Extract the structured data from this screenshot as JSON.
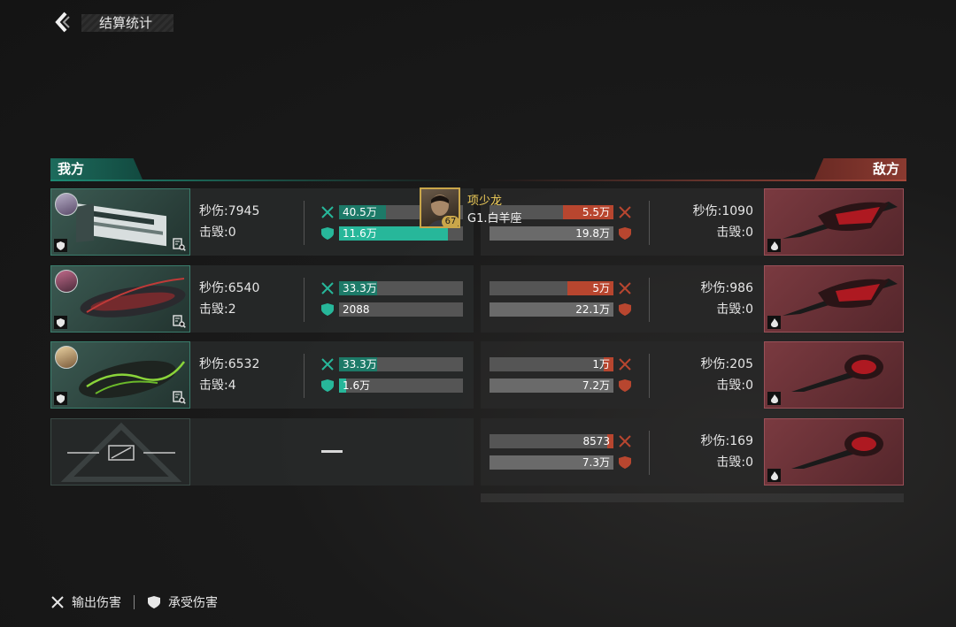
{
  "header": {
    "title": "结算统计"
  },
  "sides": {
    "ours": "我方",
    "enemy": "敌方"
  },
  "mvp": {
    "name": "项少龙",
    "rank": "G1.白羊座",
    "level": "67"
  },
  "ours": [
    {
      "dps": "秒伤:7945",
      "kills": "击毁:0",
      "dealt": "40.5万",
      "dealt_pct": 0.38,
      "taken": "11.6万",
      "taken_pct": 0.88
    },
    {
      "dps": "秒伤:6540",
      "kills": "击毁:2",
      "dealt": "33.3万",
      "dealt_pct": 0.31,
      "taken": "2088",
      "taken_pct": 0.0
    },
    {
      "dps": "秒伤:6532",
      "kills": "击毁:4",
      "dealt": "33.3万",
      "dealt_pct": 0.31,
      "taken": "1.6万",
      "taken_pct": 0.06
    }
  ],
  "enemy": [
    {
      "dps": "秒伤:1090",
      "kills": "击毁:0",
      "dealt": "5.5万",
      "dealt_pct": 0.41,
      "taken": "19.8万",
      "taken_pct": 1.0
    },
    {
      "dps": "秒伤:986",
      "kills": "击毁:0",
      "dealt": "5万",
      "dealt_pct": 0.37,
      "taken": "22.1万",
      "taken_pct": 1.0
    },
    {
      "dps": "秒伤:205",
      "kills": "击毁:0",
      "dealt": "1万",
      "dealt_pct": 0.08,
      "taken": "7.2万",
      "taken_pct": 1.0
    },
    {
      "dps": "秒伤:169",
      "kills": "击毁:0",
      "dealt": "8573",
      "dealt_pct": 0.05,
      "taken": "7.3万",
      "taken_pct": 1.0
    }
  ],
  "empty_slot": {
    "dash": "—"
  },
  "legend": {
    "dealt": "输出伤害",
    "taken": "承受伤害"
  },
  "colors": {
    "ours_accent": "#27b79a",
    "enemy_accent": "#b8462f",
    "mvp_gold": "#f2cf5a"
  }
}
